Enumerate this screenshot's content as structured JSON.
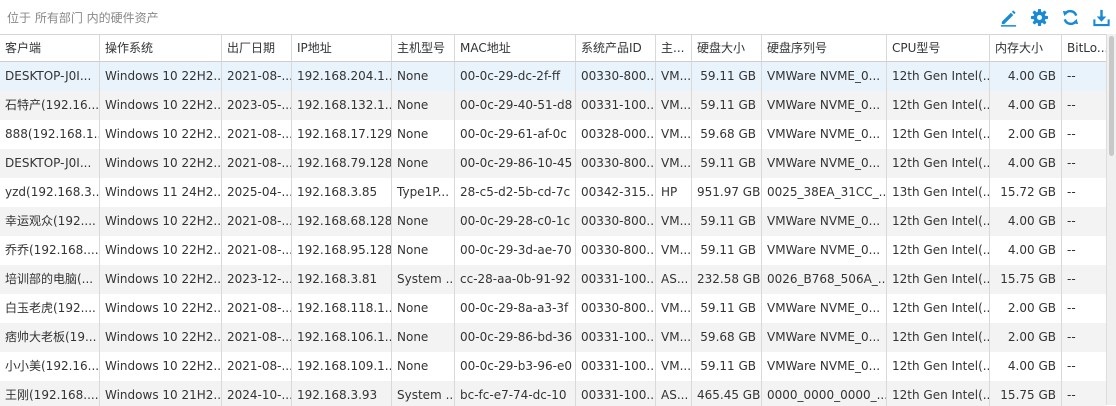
{
  "breadcrumb": "位于 所有部门 内的硬件资产",
  "toolbar": {
    "accent": "#1a8ad6",
    "icons": [
      "edit-icon",
      "gear-icon",
      "refresh-icon",
      "download-icon"
    ]
  },
  "table": {
    "columns": [
      "客户端",
      "操作系统",
      "出厂日期",
      "IP地址",
      "主机型号",
      "MAC地址",
      "系统产品ID",
      "主...",
      "硬盘大小",
      "硬盘序列号",
      "CPU型号",
      "内存大小",
      "BitLo..."
    ],
    "rows": [
      [
        "DESKTOP-J0I...",
        "Windows 10 22H2...",
        "2021-08-...",
        "192.168.204.1...",
        "None",
        "00-0c-29-dc-2f-ff",
        "00330-800...",
        "VM...",
        "59.11 GB",
        "VMWare NVME_0...",
        "12th Gen Intel(...",
        "4.00 GB",
        "--"
      ],
      [
        "石特产(192.16...",
        "Windows 10 22H2...",
        "2023-05-...",
        "192.168.132.1...",
        "None",
        "00-0c-29-40-51-d8",
        "00331-100...",
        "VM...",
        "59.11 GB",
        "VMWare NVME_0...",
        "12th Gen Intel(...",
        "4.00 GB",
        "--"
      ],
      [
        "888(192.168.1...",
        "Windows 10 22H2...",
        "2021-08-...",
        "192.168.17.129",
        "None",
        "00-0c-29-61-af-0c",
        "00328-000...",
        "VM...",
        "59.68 GB",
        "VMWare NVME_0...",
        "12th Gen Intel(...",
        "2.00 GB",
        "--"
      ],
      [
        "DESKTOP-J0I...",
        "Windows 10 22H2...",
        "2021-08-...",
        "192.168.79.128",
        "None",
        "00-0c-29-86-10-45",
        "00330-800...",
        "VM...",
        "59.11 GB",
        "VMWare NVME_0...",
        "12th Gen Intel(...",
        "4.00 GB",
        "--"
      ],
      [
        "yzd(192.168.3...",
        "Windows 11 24H2...",
        "2025-04-...",
        "192.168.3.85",
        "Type1P...",
        "28-c5-d2-5b-cd-7c",
        "00342-315...",
        "HP",
        "951.97 GB",
        "0025_38EA_31CC_...",
        "13th Gen Intel(...",
        "15.72 GB",
        "--"
      ],
      [
        "幸运观众(192....",
        "Windows 10 22H2...",
        "2021-08-...",
        "192.168.68.128",
        "None",
        "00-0c-29-28-c0-1c",
        "00330-800...",
        "VM...",
        "59.11 GB",
        "VMWare NVME_0...",
        "12th Gen Intel(...",
        "4.00 GB",
        "--"
      ],
      [
        "乔乔(192.168....",
        "Windows 10 22H2...",
        "2021-08-...",
        "192.168.95.128",
        "None",
        "00-0c-29-3d-ae-70",
        "00330-800...",
        "VM...",
        "59.11 GB",
        "VMWare NVME_0...",
        "12th Gen Intel(...",
        "4.00 GB",
        "--"
      ],
      [
        "培训部的电脑(...",
        "Windows 10 22H2...",
        "2023-12-...",
        "192.168.3.81",
        "System ...",
        "cc-28-aa-0b-91-92",
        "00331-100...",
        "AS...",
        "232.58 GB",
        "0026_B768_506A_...",
        "12th Gen Intel(...",
        "15.75 GB",
        "--"
      ],
      [
        "白玉老虎(192....",
        "Windows 10 22H2...",
        "2021-08-...",
        "192.168.118.1...",
        "None",
        "00-0c-29-8a-a3-3f",
        "00330-800...",
        "VM...",
        "59.11 GB",
        "VMWare NVME_0...",
        "12th Gen Intel(...",
        "2.00 GB",
        "--"
      ],
      [
        "痞帅大老板(19...",
        "Windows 10 22H2...",
        "2021-08-...",
        "192.168.106.1...",
        "None",
        "00-0c-29-86-bd-36",
        "00331-100...",
        "VM...",
        "59.68 GB",
        "VMWare NVME_0...",
        "12th Gen Intel(...",
        "2.00 GB",
        "--"
      ],
      [
        "小小美(192.16...",
        "Windows 10 22H2...",
        "2021-08-...",
        "192.168.109.1...",
        "None",
        "00-0c-29-b3-96-e0",
        "00331-100...",
        "VM...",
        "59.11 GB",
        "VMWare NVME_0...",
        "12th Gen Intel(...",
        "4.00 GB",
        "--"
      ],
      [
        "王刚(192.168....",
        "Windows 10 21H2...",
        "2024-10-...",
        "192.168.3.93",
        "System ...",
        "bc-fc-e7-74-dc-10",
        "00331-100...",
        "AS...",
        "465.45 GB",
        "0000_0000_0000_...",
        "12th Gen Intel(...",
        "15.75 GB",
        "--"
      ]
    ]
  }
}
